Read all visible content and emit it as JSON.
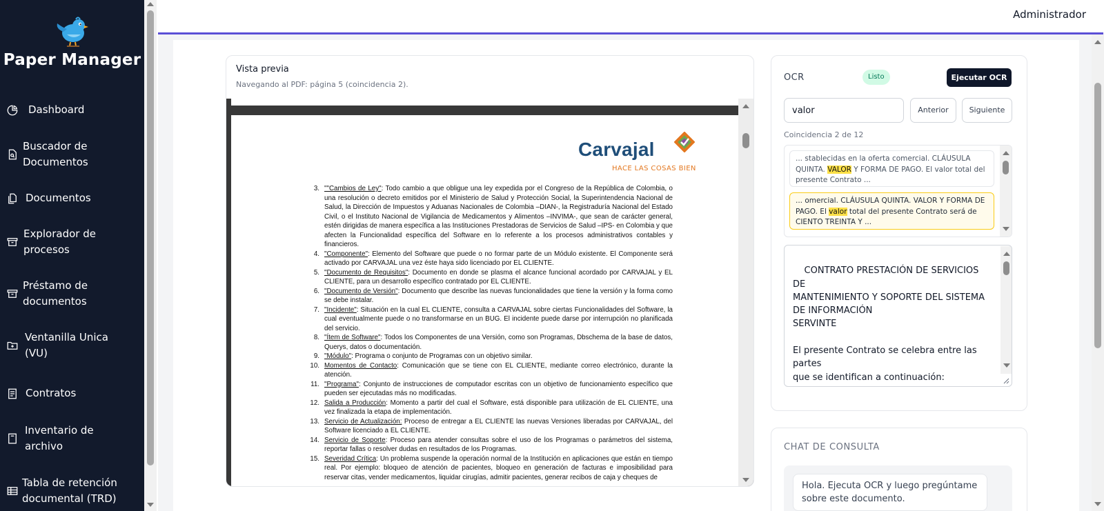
{
  "app": {
    "brand": "Paper Manager",
    "user": "Administrador"
  },
  "sidebar": {
    "items": [
      {
        "label": "Dashboard",
        "icon": "pie-chart-icon"
      },
      {
        "label": "Buscador de Documentos",
        "icon": "document-search-icon"
      },
      {
        "label": "Documentos",
        "icon": "documents-icon"
      },
      {
        "label": "Explorador de procesos",
        "icon": "archive-box-icon"
      },
      {
        "label": "Préstamo de documentos",
        "icon": "archive-box-icon"
      },
      {
        "label": "Ventanilla Unica (VU)",
        "icon": "folder-plus-icon"
      },
      {
        "label": "Contratos",
        "icon": "contract-icon"
      },
      {
        "label": "Inventario de archivo",
        "icon": "inventory-icon"
      },
      {
        "label": "Tabla de retención documental (TRD)",
        "icon": "table-icon"
      }
    ]
  },
  "preview": {
    "title": "Vista previa",
    "subtitle": "Navegando al PDF: página 5 (coincidencia 2).",
    "logo_text": "Carvajal",
    "logo_tagline": "HACE LAS COSAS BIEN",
    "items": [
      {
        "num": "3.",
        "term": "\"\"Cambios de Ley\"",
        "text": ": Todo cambio a que obligue una ley expedida por el Congreso de la República de Colombia, o una resolución o decreto emitidos por el Ministerio de Salud y Protección Social, la Superintendencia Nacional de Salud, la Dirección de Impuestos y Aduanas Nacionales de Colombia –DIAN-, la Registraduría Nacional del Estado Civil, o el Instituto Nacional de Vigilancia de Medicamentos y Alimentos –INVIMA-, que sean de carácter general, estén dirigidas de manera específica a las Instituciones Prestadoras de Servicios de Salud –IPS- en Colombia y que afecten la Funcionalidad específica del Software en lo referente a los procesos administrativos contables y financieros."
      },
      {
        "num": "4.",
        "term": "\"Componente\"",
        "text": ": Elemento del Software que puede o no formar parte de un Módulo existente. El Componente será activado por CARVAJAL una vez éste haya sido licenciado por EL CLIENTE."
      },
      {
        "num": "5.",
        "term": "\"Documento de Requisitos\"",
        "text": ": Documento en donde se plasma el alcance funcional acordado por CARVAJAL y EL CLIENTE, para un desarrollo específico contratado por EL CLIENTE."
      },
      {
        "num": "6.",
        "term": "\"Documento de Versión\"",
        "text": ": Documento que describe las nuevas funcionalidades que tiene la versión y la forma como se debe instalar."
      },
      {
        "num": "7.",
        "term": "\"Incidente\"",
        "text": ": Situación en la cual EL CLIENTE, consulta a CARVAJAL sobre ciertas Funcionalidades del Software, la cual eventualmente puede o no transformarse en un BUG. El incidente puede darse por interrupción no planificada del servicio."
      },
      {
        "num": "8.",
        "term": "\"Ítem de Software\"",
        "text": ": Todos los Componentes de una Versión, como son Programas, Dbschema de la base de datos, Querys, datos o documentación."
      },
      {
        "num": "9.",
        "term": "\"Módulo\"",
        "text": ": Programa o conjunto de Programas con un objetivo similar."
      },
      {
        "num": "10.",
        "term": "Momentos de Contacto",
        "text": ": Comunicación que se tiene con EL CLIENTE, mediante correo electrónico, durante la atención."
      },
      {
        "num": "11.",
        "term": "\"Programa\"",
        "text": ": Conjunto de instrucciones de computador escritas con un objetivo de funcionamiento específico que pueden ser ejecutadas más no modificadas."
      },
      {
        "num": "12.",
        "term": "Salida a Producción",
        "text": ": Momento a partir del cual el Software, está disponible para utilización de EL CLIENTE, una vez finalizada la etapa de implementación."
      },
      {
        "num": "13.",
        "term": "Servicio de Actualización:",
        "text": " Proceso de entregar a EL CLIENTE las nuevas Versiones liberadas por CARVAJAL, del Software licenciado a EL CLIENTE."
      },
      {
        "num": "14.",
        "term": "Servicio de Soporte",
        "text": ": Proceso para atender consultas sobre el uso de los Programas o parámetros del sistema, reportar fallas o resolver dudas en resultados de los Programas."
      },
      {
        "num": "15.",
        "term": "Severidad Crítica",
        "text": ": Un problema suspende la operación normal de la Institución en aplicaciones que están en tiempo real. Por ejemplo: bloqueo de atención de pacientes, bloqueo en generación de facturas e imposibilidad para reservar citas, vender medicamentos, liquidar cirugías, admitir pacientes, generar recibos de caja y cheques de"
      }
    ]
  },
  "ocr": {
    "title": "OCR",
    "status": "Listo",
    "run_label": "Ejecutar OCR",
    "search_value": "valor",
    "prev_label": "Anterior",
    "next_label": "Siguiente",
    "match_info": "Coincidencia 2 de 12",
    "matches": [
      {
        "before": "... stablecidas en la oferta comercial. CLÁUSULA QUINTA. ",
        "hit": "VALOR",
        "after": " Y FORMA DE PAGO. El valor total del presente Contrato ..."
      },
      {
        "before": "... omercial. CLÁUSULA QUINTA. VALOR Y FORMA DE PAGO. El ",
        "hit": "valor",
        "after": " total del presente Contrato será de CIENTO TREINTA Y ..."
      }
    ],
    "full_text": "CONTRATO PRESTACIÓN DE SERVICIOS DE\nMANTENIMIENTO Y SOPORTE DEL SISTEMA\nDE INFORMACIÓN\nSERVINTE\n\nEl presente Contrato se celebra entre las partes\nque se identifican a continuación:\n\n(i)\n\n(ii)"
  },
  "chat": {
    "title": "CHAT DE CONSULTA",
    "greeting": "Hola. Ejecuta OCR y luego pregúntame sobre este documento."
  },
  "colors": {
    "sidebar_bg": "#121a2c",
    "accent_line": "#5b4fd6",
    "badge_green": "#d1fae5",
    "highlight": "#fde047",
    "carvajal_blue": "#1f4e79",
    "carvajal_orange": "#e3771f"
  }
}
